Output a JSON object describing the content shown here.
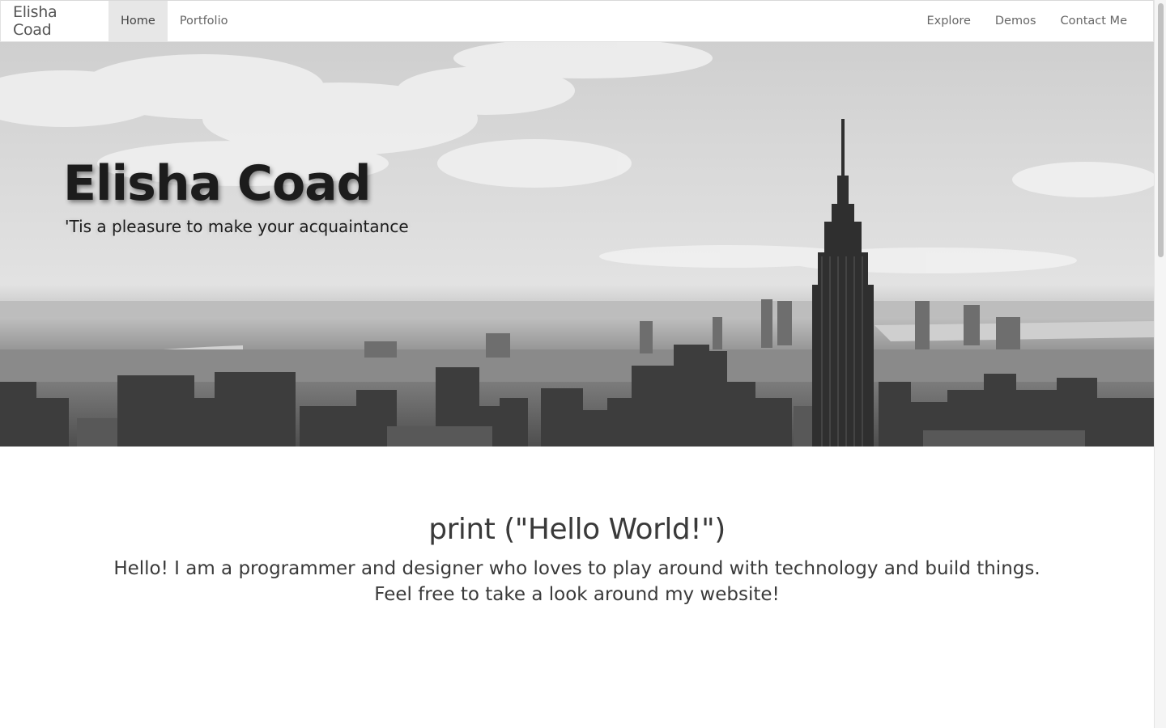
{
  "navbar": {
    "brand": "Elisha Coad",
    "left_items": [
      {
        "label": "Home",
        "active": true
      },
      {
        "label": "Portfolio",
        "active": false
      }
    ],
    "right_items": [
      {
        "label": "Explore"
      },
      {
        "label": "Demos"
      },
      {
        "label": "Contact Me"
      }
    ]
  },
  "hero": {
    "title": "Elisha Coad",
    "subtitle": "'Tis a pleasure to make your acquaintance",
    "image_description": "black-and-white-city-skyline"
  },
  "intro": {
    "heading": "print (\"Hello World!\")",
    "line1": "Hello! I am a programmer and designer who loves to play around with technology and build things.",
    "line2": "Feel free to take a look around my website!"
  },
  "colors": {
    "nav_active_bg": "#e7e7e7",
    "text_dark": "#3a3a3a",
    "hero_title": "#1c1c1c"
  }
}
